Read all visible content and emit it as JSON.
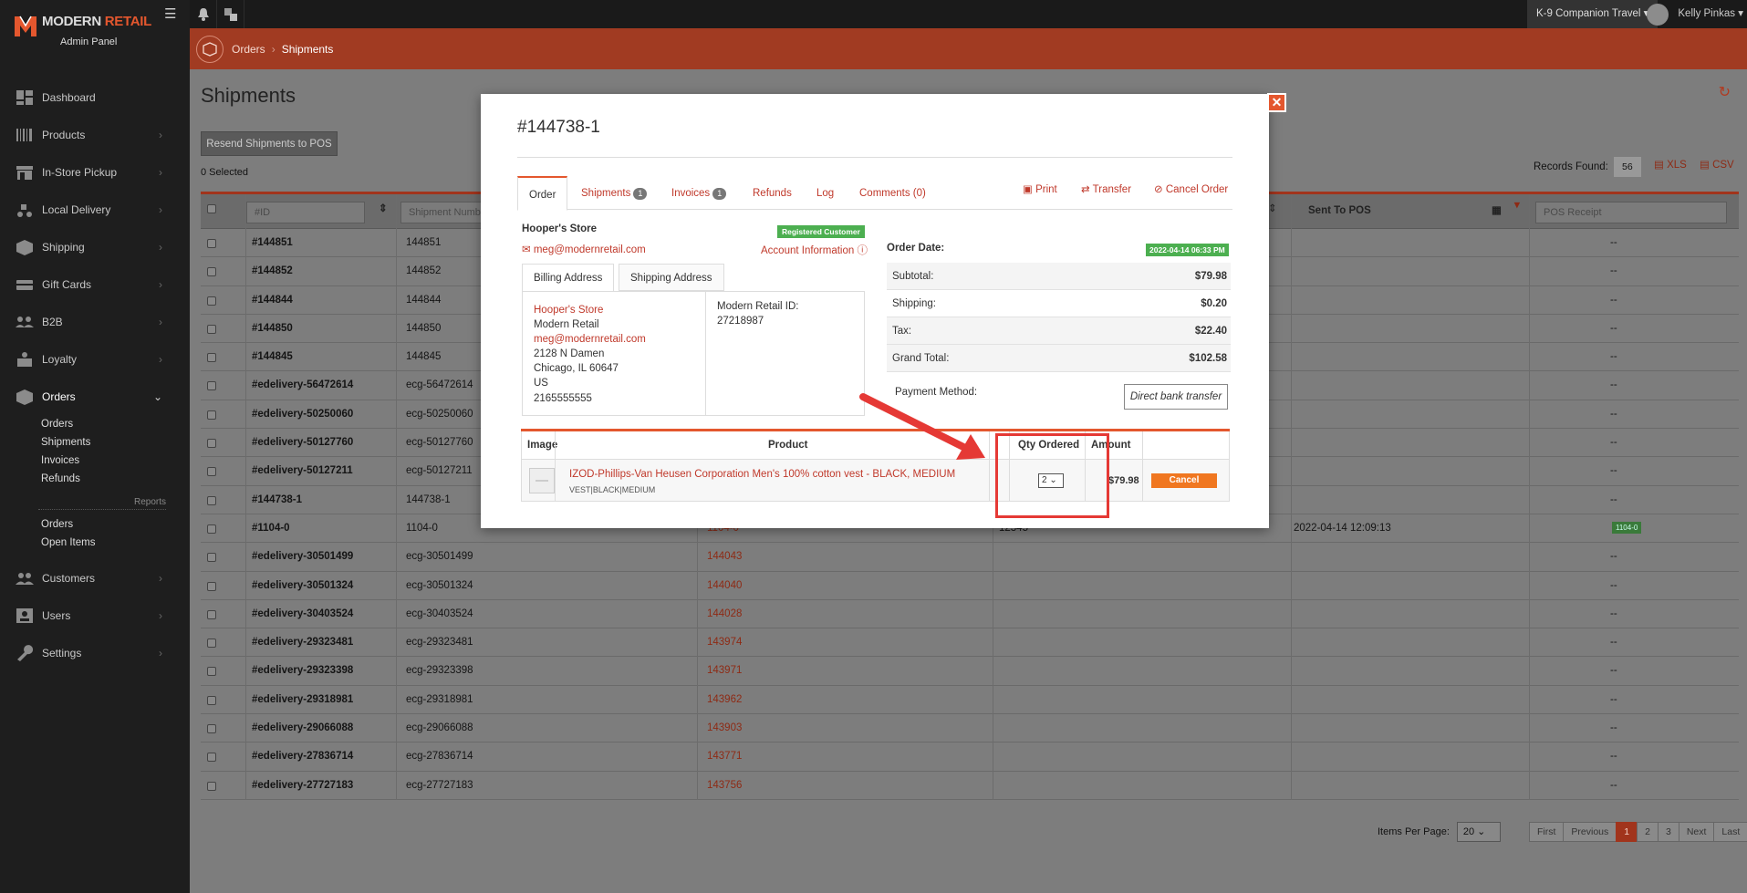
{
  "brand": {
    "name_part1": "MODERN",
    "name_part2": "RETAIL",
    "subtitle": "Admin Panel"
  },
  "sidebar": {
    "items": [
      {
        "label": "Dashboard",
        "icon": "dashboard-icon"
      },
      {
        "label": "Products",
        "icon": "barcode-icon"
      },
      {
        "label": "In-Store Pickup",
        "icon": "store-icon"
      },
      {
        "label": "Local Delivery",
        "icon": "delivery-icon"
      },
      {
        "label": "Shipping",
        "icon": "box-icon"
      },
      {
        "label": "Gift Cards",
        "icon": "gift-card-icon"
      },
      {
        "label": "B2B",
        "icon": "users-group-icon"
      },
      {
        "label": "Loyalty",
        "icon": "loyalty-icon"
      },
      {
        "label": "Orders",
        "icon": "orders-box-icon"
      }
    ],
    "orders_sub": [
      "Orders",
      "Shipments",
      "Invoices",
      "Refunds"
    ],
    "reports_label": "Reports",
    "reports_sub": [
      "Orders",
      "Open Items"
    ],
    "bottom_items": [
      {
        "label": "Customers",
        "icon": "customers-icon"
      },
      {
        "label": "Users",
        "icon": "user-card-icon"
      },
      {
        "label": "Settings",
        "icon": "wrench-icon"
      }
    ]
  },
  "topbar": {
    "store": "K-9 Companion Travel",
    "user": "Kelly Pinkas"
  },
  "breadcrumb": [
    "Orders",
    "Shipments"
  ],
  "page": {
    "title": "Shipments",
    "resend_button": "Resend Shipments to POS",
    "selected": "0 Selected",
    "records_label": "Records Found:",
    "records_count": "56",
    "xls": "XLS",
    "csv": "CSV"
  },
  "grid": {
    "id_placeholder": "#ID",
    "shipment_placeholder": "Shipment Numb",
    "sent_to_pos": "Sent To POS",
    "pos_receipt_placeholder": "POS Receipt",
    "rows": [
      {
        "id": "#144851",
        "shipment": "144851",
        "order": "",
        "ext": "",
        "date": "",
        "receipt": "--"
      },
      {
        "id": "#144852",
        "shipment": "144852",
        "order": "",
        "ext": "",
        "date": "",
        "receipt": "--"
      },
      {
        "id": "#144844",
        "shipment": "144844",
        "order": "",
        "ext": "",
        "date": "",
        "receipt": "--"
      },
      {
        "id": "#144850",
        "shipment": "144850",
        "order": "",
        "ext": "",
        "date": "",
        "receipt": "--"
      },
      {
        "id": "#144845",
        "shipment": "144845",
        "order": "",
        "ext": "",
        "date": "",
        "receipt": "--"
      },
      {
        "id": "#edelivery-56472614",
        "shipment": "ecg-56472614",
        "order": "",
        "ext": "",
        "date": "",
        "receipt": "--"
      },
      {
        "id": "#edelivery-50250060",
        "shipment": "ecg-50250060",
        "order": "",
        "ext": "",
        "date": "",
        "receipt": "--"
      },
      {
        "id": "#edelivery-50127760",
        "shipment": "ecg-50127760",
        "order": "",
        "ext": "",
        "date": "",
        "receipt": "--"
      },
      {
        "id": "#edelivery-50127211",
        "shipment": "ecg-50127211",
        "order": "",
        "ext": "",
        "date": "",
        "receipt": "--"
      },
      {
        "id": "#144738-1",
        "shipment": "144738-1",
        "order": "",
        "ext": "",
        "date": "",
        "receipt": "--"
      },
      {
        "id": "#1104-0",
        "shipment": "1104-0",
        "order": "1104-0",
        "ext": "12345",
        "date": "2022-04-14 12:09:13",
        "receipt": "1104-0"
      },
      {
        "id": "#edelivery-30501499",
        "shipment": "ecg-30501499",
        "order": "144043",
        "ext": "",
        "date": "",
        "receipt": "--"
      },
      {
        "id": "#edelivery-30501324",
        "shipment": "ecg-30501324",
        "order": "144040",
        "ext": "",
        "date": "",
        "receipt": "--"
      },
      {
        "id": "#edelivery-30403524",
        "shipment": "ecg-30403524",
        "order": "144028",
        "ext": "",
        "date": "",
        "receipt": "--"
      },
      {
        "id": "#edelivery-29323481",
        "shipment": "ecg-29323481",
        "order": "143974",
        "ext": "",
        "date": "",
        "receipt": "--"
      },
      {
        "id": "#edelivery-29323398",
        "shipment": "ecg-29323398",
        "order": "143971",
        "ext": "",
        "date": "",
        "receipt": "--"
      },
      {
        "id": "#edelivery-29318981",
        "shipment": "ecg-29318981",
        "order": "143962",
        "ext": "",
        "date": "",
        "receipt": "--"
      },
      {
        "id": "#edelivery-29066088",
        "shipment": "ecg-29066088",
        "order": "143903",
        "ext": "",
        "date": "",
        "receipt": "--"
      },
      {
        "id": "#edelivery-27836714",
        "shipment": "ecg-27836714",
        "order": "143771",
        "ext": "",
        "date": "",
        "receipt": "--"
      },
      {
        "id": "#edelivery-27727183",
        "shipment": "ecg-27727183",
        "order": "143756",
        "ext": "",
        "date": "",
        "receipt": "--"
      }
    ]
  },
  "pager": {
    "items_per_page_label": "Items Per Page:",
    "items_per_page": "20",
    "first": "First",
    "previous": "Previous",
    "pages": [
      "1",
      "2",
      "3"
    ],
    "next": "Next",
    "last": "Last"
  },
  "modal": {
    "title": "#144738-1",
    "tabs": {
      "order": "Order",
      "shipments": "Shipments",
      "shipments_count": "1",
      "invoices": "Invoices",
      "invoices_count": "1",
      "refunds": "Refunds",
      "log": "Log",
      "comments": "Comments (0)"
    },
    "actions": {
      "print": "Print",
      "transfer": "Transfer",
      "cancel_order": "Cancel Order"
    },
    "customer": {
      "store": "Hooper's Store",
      "badge": "Registered Customer",
      "email": "meg@modernretail.com",
      "account_info": "Account Information"
    },
    "address_tabs": {
      "billing": "Billing Address",
      "shipping": "Shipping Address"
    },
    "billing": {
      "name": "Hooper's Store",
      "company": "Modern Retail",
      "email": "meg@modernretail.com",
      "street": "2128 N Damen",
      "city": "Chicago, IL 60647",
      "country": "US",
      "phone": "2165555555",
      "mr_id_label": "Modern Retail ID:",
      "mr_id": "27218987"
    },
    "order_date_label": "Order Date:",
    "order_date": "2022-04-14 06:33 PM",
    "totals": [
      {
        "label": "Subtotal:",
        "value": "$79.98"
      },
      {
        "label": "Shipping:",
        "value": "$0.20"
      },
      {
        "label": "Tax:",
        "value": "$22.40"
      },
      {
        "label": "Grand Total:",
        "value": "$102.58"
      }
    ],
    "payment_method_label": "Payment Method:",
    "payment_method": "Direct bank transfer",
    "items_header": {
      "image": "Image",
      "product": "Product",
      "qty": "Qty Ordered",
      "amount": "Amount"
    },
    "item": {
      "name": "IZOD-Phillips-Van Heusen Corporation Men's 100% cotton vest - BLACK, MEDIUM",
      "variant": "VEST|BLACK|MEDIUM",
      "qty": "2",
      "amount": "$79.98",
      "cancel": "Cancel"
    }
  }
}
